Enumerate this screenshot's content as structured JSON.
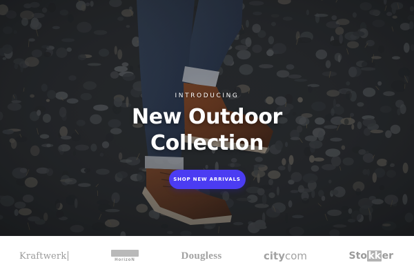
{
  "hero": {
    "eyebrow": "INTRODUCING",
    "headline_line1": "New Outdoor",
    "headline_line2": "Collection",
    "cta_label": "SHOP NEW ARRIVALS",
    "cta_color": "#4b3cf2"
  },
  "brands": {
    "kraftwerk": "Kraftwerk",
    "horizon": "HorizoN",
    "dougless": "Dougless",
    "citycom_a": "city",
    "citycom_b": "com",
    "stokker_a": "Sto",
    "stokker_b": "kk",
    "stokker_c": "er"
  }
}
